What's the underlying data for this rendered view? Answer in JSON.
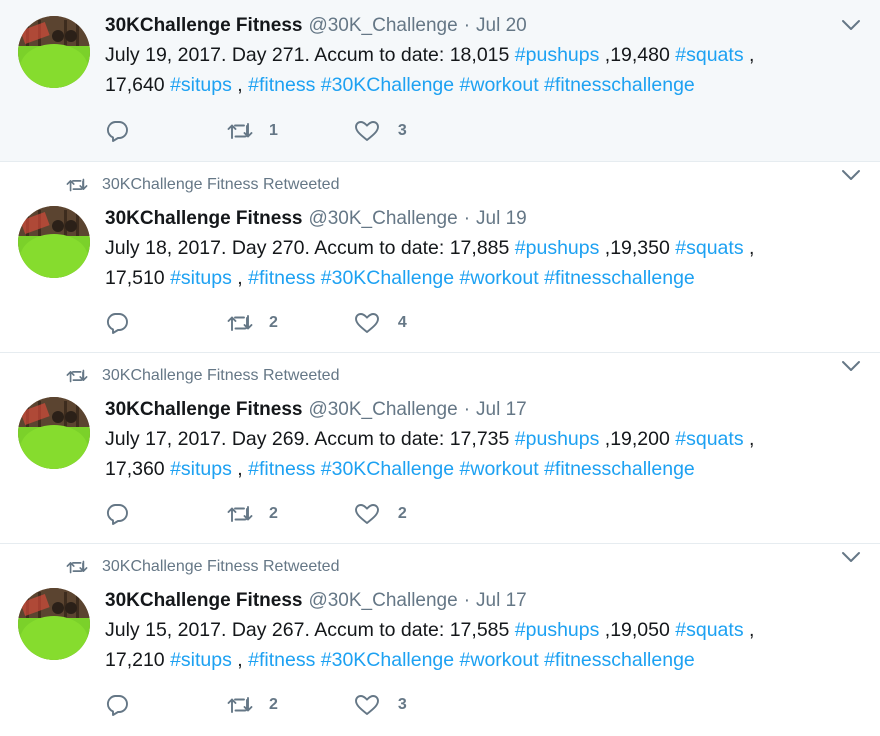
{
  "colors": {
    "link": "#1da1f2",
    "muted": "#657786",
    "highlight_bg": "#f5f8fa"
  },
  "tweets": [
    {
      "retweet_label": "",
      "name": "30KChallenge Fitness",
      "handle": "@30K_Challenge",
      "dot": "·",
      "date": "Jul 20",
      "text_a": "July 19, 2017. Day 271.  Accum to date: 18,015 ",
      "tag_pushups": "#pushups",
      "text_b": " ,19,480 ",
      "tag_squats": "#squats",
      "text_c": " ,",
      "text_d": "17,640 ",
      "tag_situps": "#situps",
      "text_e": " , ",
      "tag_fitness": "#fitness",
      "tag_30k": "#30KChallenge",
      "tag_workout": "#workout",
      "tag_fc": "#fitnesschallenge",
      "retweets": "1",
      "likes": "3"
    },
    {
      "retweet_label": "30KChallenge Fitness Retweeted",
      "name": "30KChallenge Fitness",
      "handle": "@30K_Challenge",
      "dot": "·",
      "date": "Jul 19",
      "text_a": "July 18, 2017. Day 270.  Accum to date: 17,885 ",
      "tag_pushups": "#pushups",
      "text_b": " ,19,350 ",
      "tag_squats": "#squats",
      "text_c": " ,",
      "text_d": "17,510 ",
      "tag_situps": "#situps",
      "text_e": " , ",
      "tag_fitness": "#fitness",
      "tag_30k": "#30KChallenge",
      "tag_workout": "#workout",
      "tag_fc": "#fitnesschallenge",
      "retweets": "2",
      "likes": "4"
    },
    {
      "retweet_label": "30KChallenge Fitness Retweeted",
      "name": "30KChallenge Fitness",
      "handle": "@30K_Challenge",
      "dot": "·",
      "date": "Jul 17",
      "text_a": "July 17, 2017. Day 269.  Accum to date: 17,735 ",
      "tag_pushups": "#pushups",
      "text_b": " ,19,200 ",
      "tag_squats": "#squats",
      "text_c": " ,",
      "text_d": "17,360 ",
      "tag_situps": "#situps",
      "text_e": " , ",
      "tag_fitness": "#fitness",
      "tag_30k": "#30KChallenge",
      "tag_workout": "#workout",
      "tag_fc": "#fitnesschallenge",
      "retweets": "2",
      "likes": "2"
    },
    {
      "retweet_label": "30KChallenge Fitness Retweeted",
      "name": "30KChallenge Fitness",
      "handle": "@30K_Challenge",
      "dot": "·",
      "date": "Jul 17",
      "text_a": "July 15, 2017. Day 267.  Accum to date: 17,585 ",
      "tag_pushups": "#pushups",
      "text_b": " ,19,050 ",
      "tag_squats": "#squats",
      "text_c": " ,",
      "text_d": "17,210 ",
      "tag_situps": "#situps",
      "text_e": " , ",
      "tag_fitness": "#fitness",
      "tag_30k": "#30KChallenge",
      "tag_workout": "#workout",
      "tag_fc": "#fitnesschallenge",
      "retweets": "2",
      "likes": "3"
    }
  ]
}
